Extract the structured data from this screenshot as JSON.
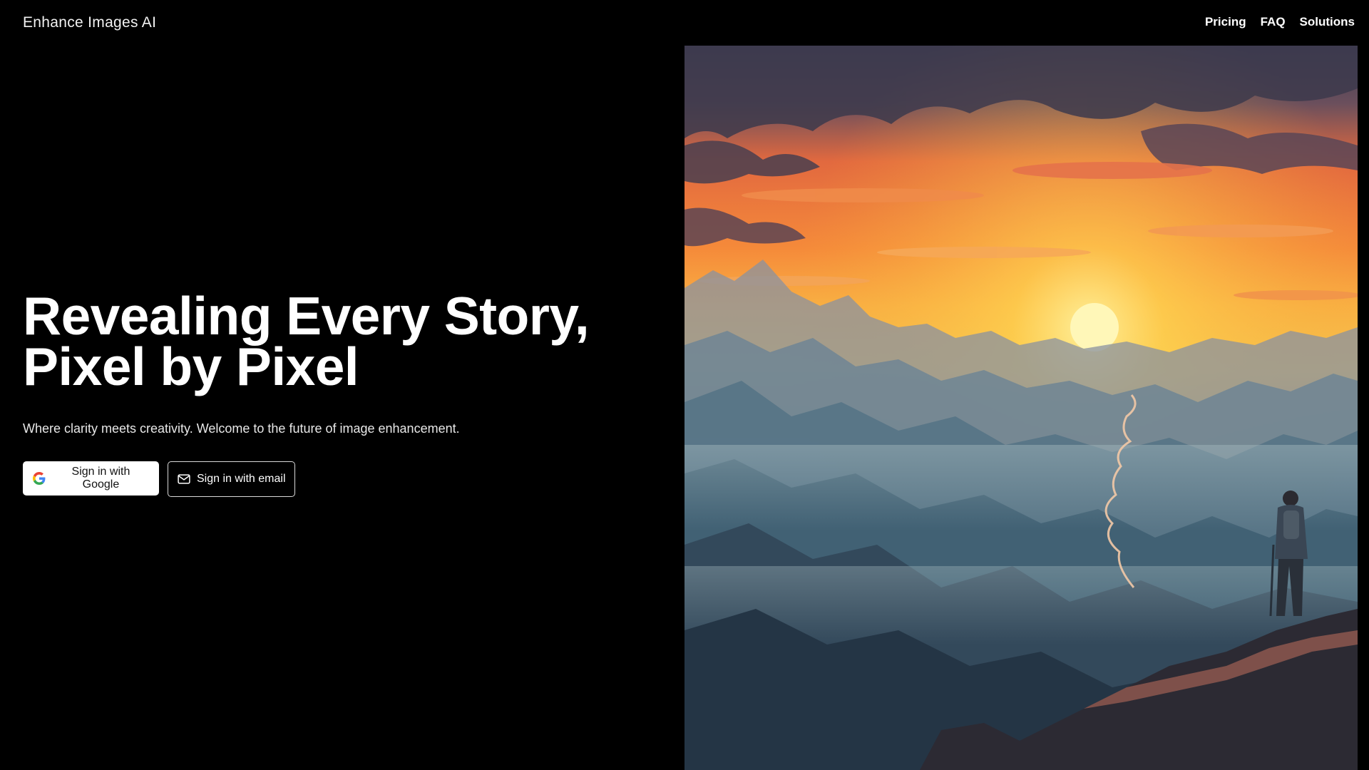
{
  "header": {
    "brand": "Enhance Images AI",
    "nav": [
      {
        "label": "Pricing"
      },
      {
        "label": "FAQ"
      },
      {
        "label": "Solutions"
      }
    ]
  },
  "hero": {
    "headline_line1": "Revealing Every Story,",
    "headline_line2": "Pixel by Pixel",
    "subtitle": "Where clarity meets creativity. Welcome to the future of image enhancement."
  },
  "actions": {
    "google_label": "Sign in with Google",
    "google_icon": "google-logo",
    "email_label": "Sign in with email",
    "email_icon": "mail-icon"
  },
  "colors": {
    "background": "#000000",
    "text": "#ffffff",
    "google_button_bg": "#ffffff",
    "email_button_border": "#d9d9d9"
  }
}
